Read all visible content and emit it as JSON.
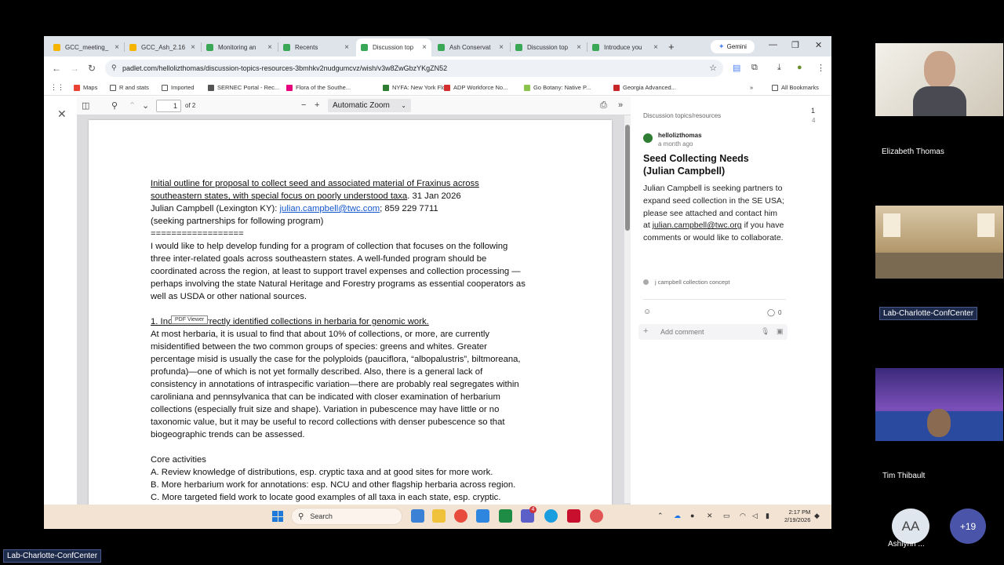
{
  "browser": {
    "tabs": [
      {
        "label": "GCC_meeting_",
        "color": "#f4b400"
      },
      {
        "label": "GCC_Ash_2.16",
        "color": "#f4b400"
      },
      {
        "label": "Monitoring an",
        "color": "#3aa757"
      },
      {
        "label": "Recents",
        "color": "#3aa757"
      },
      {
        "label": "Discussion top",
        "color": "#3aa757",
        "active": true
      },
      {
        "label": "Ash Conservat",
        "color": "#3aa757"
      },
      {
        "label": "Discussion top",
        "color": "#3aa757"
      },
      {
        "label": "Introduce you",
        "color": "#3aa757"
      }
    ],
    "tab_close": "×",
    "new_tab": "+",
    "gemini_label": "Gemini",
    "url": "padlet.com/hellolizthomas/discussion-topics-resources-3bmhkv2nudgumcvz/wish/v3w8ZwGbzYKgZN52",
    "bookmarks": [
      {
        "label": "Maps",
        "color": "#ea4335"
      },
      {
        "label": "R and stats",
        "color": "folder"
      },
      {
        "label": "Imported",
        "color": "folder"
      },
      {
        "label": "SERNEC Portal - Rec...",
        "color": "#555555"
      },
      {
        "label": "Flora of the Southe...",
        "color": "#e6007e"
      },
      {
        "label": "NYFA: New York Flo...",
        "color": "#2e7d32"
      },
      {
        "label": "ADP Workforce No...",
        "color": "#d32f2f"
      },
      {
        "label": "Go Botany: Native P...",
        "color": "#8bc34a"
      },
      {
        "label": "Georgia Advanced...",
        "color": "#c62828"
      }
    ],
    "bookmarks_more": "»",
    "all_bookmarks": "All Bookmarks"
  },
  "pdf": {
    "page_current": "1",
    "page_of": "of 2",
    "zoom": "Automatic Zoom",
    "tooltip": "PDF Viewer",
    "lines": [
      {
        "t": "Initial outline for proposal to collect seed and associated material of Fraxinus across",
        "u": true
      },
      {
        "t": "southeastern states, with special focus on poorly understood taxa",
        "u": true,
        "rest": ". 31 Jan 2026"
      },
      {
        "t": "Julian Campbell (Lexington KY): ",
        "link": "julian.campbell@twc.com",
        "rest": "; 859 229 7711"
      },
      {
        "t": "(seeking partnerships for following program)"
      },
      {
        "t": "=================="
      },
      {
        "t": "I would like to help develop funding for a program of collection that focuses on the following"
      },
      {
        "t": "three inter-related goals across southeastern states. A well-funded program should be"
      },
      {
        "t": "coordinated across the region, at least to support travel expenses and collection processing —"
      },
      {
        "t": "perhaps involving the state Natural Heritage and Forestry programs as essential cooperators as"
      },
      {
        "t": "well as USDA or other national sources."
      },
      {
        "t": ""
      },
      {
        "t": "1. Increase correctly identified collections in herbaria for genomic work.",
        "u": true
      },
      {
        "t": "At most herbaria, it is usual to find that about 10% of collections, or more, are currently"
      },
      {
        "t": "misidentified between the two common groups of species: greens and whites. Greater"
      },
      {
        "t": "percentage misid is usually the case for the polyploids (pauciflora, “albopalustris”, biltmoreana,"
      },
      {
        "t": "profunda)—one of which is not yet formally described. Also, there is a general lack of"
      },
      {
        "t": "consistency in annotations of intraspecific variation—there are probably real segregates within"
      },
      {
        "t": "caroliniana and pennsylvanica that can be indicated with closer examination of herbarium"
      },
      {
        "t": "collections (especially fruit size and shape). Variation in pubescence may have little or no"
      },
      {
        "t": "taxonomic value, but it may be useful to record collections with denser pubescence so that"
      },
      {
        "t": "biogeographic trends can be assessed."
      },
      {
        "t": ""
      },
      {
        "t": "Core activities"
      },
      {
        "t": "A. Review knowledge of distributions, esp. cryptic taxa and at good sites for more work."
      },
      {
        "t": "B. More herbarium work for annotations: esp. NCU and other flagship herbaria across region."
      },
      {
        "t": "C. More targeted field work to locate good examples of all taxa in each state, esp. cryptic."
      }
    ]
  },
  "padlet": {
    "breadcrumb": "Discussion topics/resources",
    "page_index": "1",
    "page_total": "4",
    "author": "hellolizthomas",
    "time": "a month ago",
    "title": "Seed Collecting Needs (Julian Campbell)",
    "body_pre": "Julian Campbell is seeking partners to expand seed collection in the SE USA; please see attached and contact him at ",
    "body_link": "julian.campbell@twc.org",
    "body_post": " if you have comments or would like to collaborate.",
    "attachment": "j campbell collection concept",
    "comment_count": "0",
    "comment_placeholder": "Add comment"
  },
  "taskbar": {
    "search": "Search",
    "time": "2:17 PM",
    "date": "2/19/2026",
    "badge": "4"
  },
  "meeting": {
    "participants": [
      {
        "name": "Elizabeth Thomas"
      },
      {
        "name": "Lab-Charlotte-ConfCenter"
      },
      {
        "name": "Tim Thibault"
      }
    ],
    "initials": "AA",
    "initials_name": "Ashlynn ...",
    "more_count": "+19",
    "self_label": "Lab-Charlotte-ConfCenter"
  }
}
